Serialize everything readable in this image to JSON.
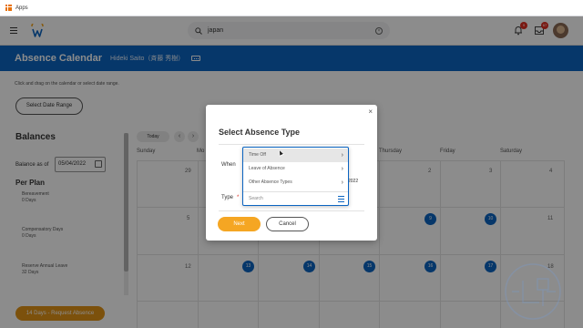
{
  "browser": {
    "apps_label": "Apps"
  },
  "header": {
    "search_value": "japan",
    "notifications_count": "9",
    "inbox_count": "67"
  },
  "title_band": {
    "title": "Absence Calendar",
    "worker": "Hideki Saito（斉藤 秀樹）"
  },
  "page": {
    "instruction": "Click and drag on the calendar or select date range.",
    "select_date_range": "Select Date Range"
  },
  "balances": {
    "title": "Balances",
    "as_of_label": "Balance as of",
    "as_of_date": "05/04/2022",
    "per_plan": "Per Plan",
    "plans": [
      {
        "name": "Bereavement",
        "value": "0 Days"
      },
      {
        "name": "Compensatory Days",
        "value": "0 Days"
      },
      {
        "name": "Reserve Annual Leave",
        "value": "32 Days"
      }
    ]
  },
  "request_button": "14 Days - Request Absence",
  "calendar": {
    "today_label": "Today",
    "prev_icon": "‹",
    "next_icon": "›",
    "days_of_week": [
      "Sunday",
      "Mo",
      "",
      "",
      "Thursday",
      "Friday",
      "Saturday"
    ],
    "row1": [
      "29",
      "",
      "",
      "",
      "",
      "2",
      "3",
      "4"
    ],
    "row2": [
      "5",
      "",
      "",
      "",
      "9",
      "10",
      "11"
    ],
    "row3": [
      "12",
      "13",
      "14",
      "15",
      "16",
      "17",
      "18"
    ]
  },
  "modal": {
    "title": "Select Absence Type",
    "when_label": "When",
    "type_label": "Type",
    "required_mark": "*",
    "when_date_partial": "2022",
    "next_button": "Next",
    "cancel_button": "Cancel",
    "close_icon": "×"
  },
  "dropdown": {
    "items": [
      {
        "label": "Time Off"
      },
      {
        "label": "Leave of Absence"
      },
      {
        "label": "Other Absence Types"
      }
    ],
    "search_placeholder": "Search",
    "chevron": "›"
  },
  "colors": {
    "brand_blue": "#0b64c1",
    "accent_orange": "#f5a623"
  }
}
